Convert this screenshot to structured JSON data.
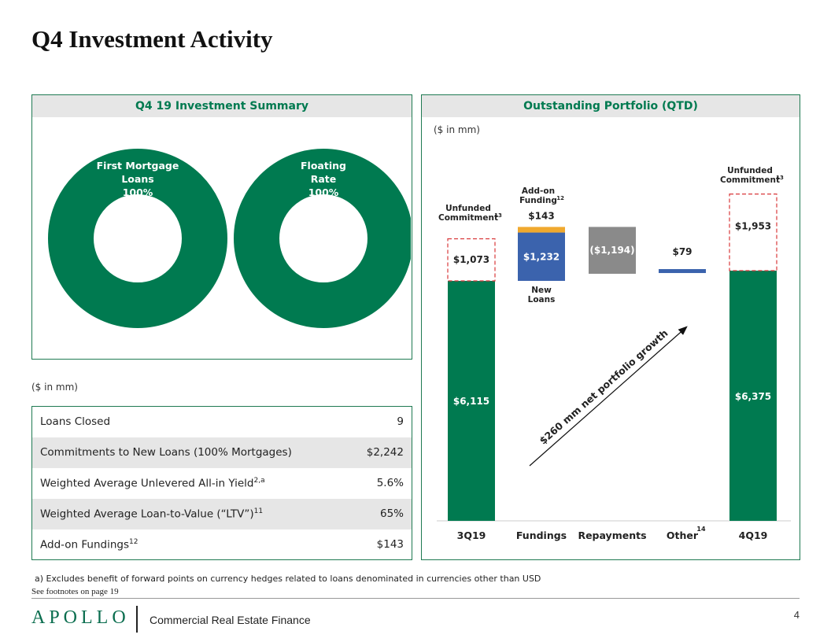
{
  "page": {
    "title": "Q4 Investment Activity",
    "footnote": "a) Excludes benefit of forward points on currency hedges related to loans denominated in currencies other than USD",
    "see_footnotes": "See footnotes on page 19",
    "logo": "APOLLO",
    "sub_brand": "Commercial Real Estate Finance",
    "page_number": "4",
    "accent_color": "#007a50"
  },
  "summary_panel": {
    "title": "Q4 19 Investment Summary",
    "donuts": [
      {
        "lines": [
          "First Mortgage",
          "Loans",
          "100%"
        ],
        "percent": 100,
        "color": "#007a50"
      },
      {
        "lines": [
          "Floating",
          "Rate",
          "100%"
        ],
        "percent": 100,
        "color": "#007a50"
      }
    ]
  },
  "table": {
    "unit_label": "($ in mm)",
    "rows": [
      {
        "label": "Loans Closed",
        "sup": "",
        "label_suffix": "",
        "value": "9"
      },
      {
        "label": "Commitments to New Loans (100% Mortgages)",
        "sup": "",
        "label_suffix": "",
        "value": "$2,242"
      },
      {
        "label": "Weighted Average Unlevered All-in Yield",
        "sup": "2,a",
        "label_suffix": "",
        "value": "5.6%"
      },
      {
        "label": "Weighted Average Loan-to-Value (“LTV”)",
        "sup": "11",
        "label_suffix": "",
        "value": "65%"
      },
      {
        "label": "Add-on Fundings",
        "sup": "12",
        "label_suffix": "",
        "value": "$143"
      }
    ]
  },
  "chart_data": {
    "type": "bar",
    "subtype": "waterfall",
    "title": "Outstanding Portfolio (QTD)",
    "unit_label": "($ in mm)",
    "categories": [
      "3Q19",
      "Fundings",
      "Repayments",
      "Other",
      "4Q19"
    ],
    "category_sups": [
      "",
      "",
      "",
      "14",
      ""
    ],
    "bars": [
      {
        "category": "3Q19",
        "base": 0,
        "value": 6115,
        "label": "$6,115",
        "color": "#007a50",
        "kind": "total"
      },
      {
        "category": "3Q19",
        "base": 6115,
        "value": 1073,
        "label": "$1,073",
        "color": "none",
        "kind": "unfunded"
      },
      {
        "category": "Fundings",
        "base": 6115,
        "value": 1232,
        "label": "$1,232",
        "color": "#3b63ad",
        "kind": "increase"
      },
      {
        "category": "Fundings",
        "base": 7347,
        "value": 143,
        "label": "$143",
        "color": "#f0a92e",
        "kind": "increase"
      },
      {
        "category": "Repayments",
        "base": 6296,
        "value": 1194,
        "label": "($1,194)",
        "color": "#8a8a8a",
        "kind": "decrease"
      },
      {
        "category": "Other",
        "base": 6296,
        "value": 79,
        "label": "$79",
        "color": "#3b63ad",
        "kind": "increase"
      },
      {
        "category": "4Q19",
        "base": 0,
        "value": 6375,
        "label": "$6,375",
        "color": "#007a50",
        "kind": "total"
      },
      {
        "category": "4Q19",
        "base": 6375,
        "value": 1953,
        "label": "$1,953",
        "color": "none",
        "kind": "unfunded"
      }
    ],
    "annotations": {
      "unfunded_left": {
        "text": [
          "Unfunded",
          "Commitment"
        ],
        "sup": "13"
      },
      "addon": {
        "text": [
          "Add-on",
          "Funding"
        ],
        "sup": "12"
      },
      "new_loans": [
        "New",
        "Loans"
      ],
      "unfunded_right": {
        "text": [
          "Unfunded",
          "Commitment"
        ],
        "sup": "13"
      },
      "growth_arrow": "$260 mm net portfolio growth"
    },
    "ylim": [
      0,
      8400
    ]
  }
}
